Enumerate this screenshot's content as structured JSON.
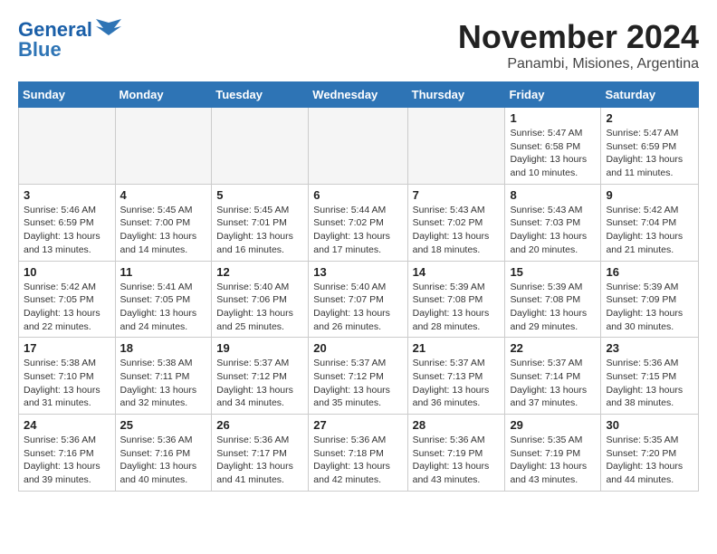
{
  "header": {
    "logo": {
      "line1": "General",
      "line2": "Blue"
    },
    "title": "November 2024",
    "subtitle": "Panambi, Misiones, Argentina"
  },
  "weekdays": [
    "Sunday",
    "Monday",
    "Tuesday",
    "Wednesday",
    "Thursday",
    "Friday",
    "Saturday"
  ],
  "weeks": [
    [
      {
        "day": "",
        "info": ""
      },
      {
        "day": "",
        "info": ""
      },
      {
        "day": "",
        "info": ""
      },
      {
        "day": "",
        "info": ""
      },
      {
        "day": "",
        "info": ""
      },
      {
        "day": "1",
        "info": "Sunrise: 5:47 AM\nSunset: 6:58 PM\nDaylight: 13 hours and 10 minutes."
      },
      {
        "day": "2",
        "info": "Sunrise: 5:47 AM\nSunset: 6:59 PM\nDaylight: 13 hours and 11 minutes."
      }
    ],
    [
      {
        "day": "3",
        "info": "Sunrise: 5:46 AM\nSunset: 6:59 PM\nDaylight: 13 hours and 13 minutes."
      },
      {
        "day": "4",
        "info": "Sunrise: 5:45 AM\nSunset: 7:00 PM\nDaylight: 13 hours and 14 minutes."
      },
      {
        "day": "5",
        "info": "Sunrise: 5:45 AM\nSunset: 7:01 PM\nDaylight: 13 hours and 16 minutes."
      },
      {
        "day": "6",
        "info": "Sunrise: 5:44 AM\nSunset: 7:02 PM\nDaylight: 13 hours and 17 minutes."
      },
      {
        "day": "7",
        "info": "Sunrise: 5:43 AM\nSunset: 7:02 PM\nDaylight: 13 hours and 18 minutes."
      },
      {
        "day": "8",
        "info": "Sunrise: 5:43 AM\nSunset: 7:03 PM\nDaylight: 13 hours and 20 minutes."
      },
      {
        "day": "9",
        "info": "Sunrise: 5:42 AM\nSunset: 7:04 PM\nDaylight: 13 hours and 21 minutes."
      }
    ],
    [
      {
        "day": "10",
        "info": "Sunrise: 5:42 AM\nSunset: 7:05 PM\nDaylight: 13 hours and 22 minutes."
      },
      {
        "day": "11",
        "info": "Sunrise: 5:41 AM\nSunset: 7:05 PM\nDaylight: 13 hours and 24 minutes."
      },
      {
        "day": "12",
        "info": "Sunrise: 5:40 AM\nSunset: 7:06 PM\nDaylight: 13 hours and 25 minutes."
      },
      {
        "day": "13",
        "info": "Sunrise: 5:40 AM\nSunset: 7:07 PM\nDaylight: 13 hours and 26 minutes."
      },
      {
        "day": "14",
        "info": "Sunrise: 5:39 AM\nSunset: 7:08 PM\nDaylight: 13 hours and 28 minutes."
      },
      {
        "day": "15",
        "info": "Sunrise: 5:39 AM\nSunset: 7:08 PM\nDaylight: 13 hours and 29 minutes."
      },
      {
        "day": "16",
        "info": "Sunrise: 5:39 AM\nSunset: 7:09 PM\nDaylight: 13 hours and 30 minutes."
      }
    ],
    [
      {
        "day": "17",
        "info": "Sunrise: 5:38 AM\nSunset: 7:10 PM\nDaylight: 13 hours and 31 minutes."
      },
      {
        "day": "18",
        "info": "Sunrise: 5:38 AM\nSunset: 7:11 PM\nDaylight: 13 hours and 32 minutes."
      },
      {
        "day": "19",
        "info": "Sunrise: 5:37 AM\nSunset: 7:12 PM\nDaylight: 13 hours and 34 minutes."
      },
      {
        "day": "20",
        "info": "Sunrise: 5:37 AM\nSunset: 7:12 PM\nDaylight: 13 hours and 35 minutes."
      },
      {
        "day": "21",
        "info": "Sunrise: 5:37 AM\nSunset: 7:13 PM\nDaylight: 13 hours and 36 minutes."
      },
      {
        "day": "22",
        "info": "Sunrise: 5:37 AM\nSunset: 7:14 PM\nDaylight: 13 hours and 37 minutes."
      },
      {
        "day": "23",
        "info": "Sunrise: 5:36 AM\nSunset: 7:15 PM\nDaylight: 13 hours and 38 minutes."
      }
    ],
    [
      {
        "day": "24",
        "info": "Sunrise: 5:36 AM\nSunset: 7:16 PM\nDaylight: 13 hours and 39 minutes."
      },
      {
        "day": "25",
        "info": "Sunrise: 5:36 AM\nSunset: 7:16 PM\nDaylight: 13 hours and 40 minutes."
      },
      {
        "day": "26",
        "info": "Sunrise: 5:36 AM\nSunset: 7:17 PM\nDaylight: 13 hours and 41 minutes."
      },
      {
        "day": "27",
        "info": "Sunrise: 5:36 AM\nSunset: 7:18 PM\nDaylight: 13 hours and 42 minutes."
      },
      {
        "day": "28",
        "info": "Sunrise: 5:36 AM\nSunset: 7:19 PM\nDaylight: 13 hours and 43 minutes."
      },
      {
        "day": "29",
        "info": "Sunrise: 5:35 AM\nSunset: 7:19 PM\nDaylight: 13 hours and 43 minutes."
      },
      {
        "day": "30",
        "info": "Sunrise: 5:35 AM\nSunset: 7:20 PM\nDaylight: 13 hours and 44 minutes."
      }
    ]
  ]
}
